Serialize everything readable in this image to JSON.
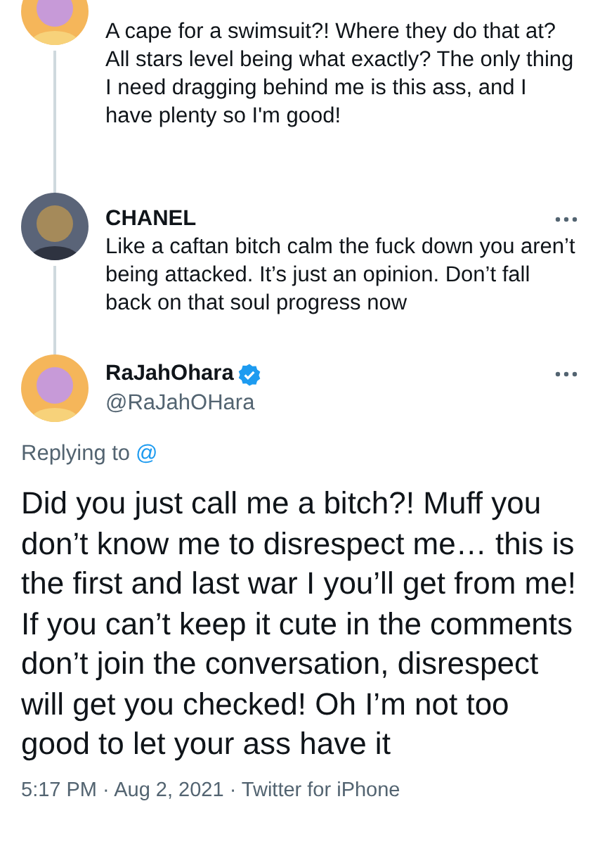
{
  "thread": [
    {
      "text": "A cape for a swimsuit?! Where they do that at? All stars level being what exactly? The only thing I need dragging behind me is this ass, and I have plenty so I'm good!"
    },
    {
      "name": "CHANEL",
      "text": "Like a caftan bitch calm the fuck down you aren’t being attacked. It’s just an opinion. Don’t fall back on that soul progress now"
    }
  ],
  "main_tweet": {
    "name": "RaJahOhara",
    "verified": true,
    "handle": "@RaJahOHara",
    "replying_label": "Replying to",
    "replying_to": "@",
    "text": "Did you just call me a bitch?! Muff you don’t know me to disrespect me… this is the first and last war I you’ll get from me! If you can’t keep it cute in the comments don’t join the conversation, disrespect will get you checked! Oh I’m not too good to let your ass have it",
    "meta": "5:17 PM · Aug 2, 2021 · Twitter for iPhone"
  }
}
